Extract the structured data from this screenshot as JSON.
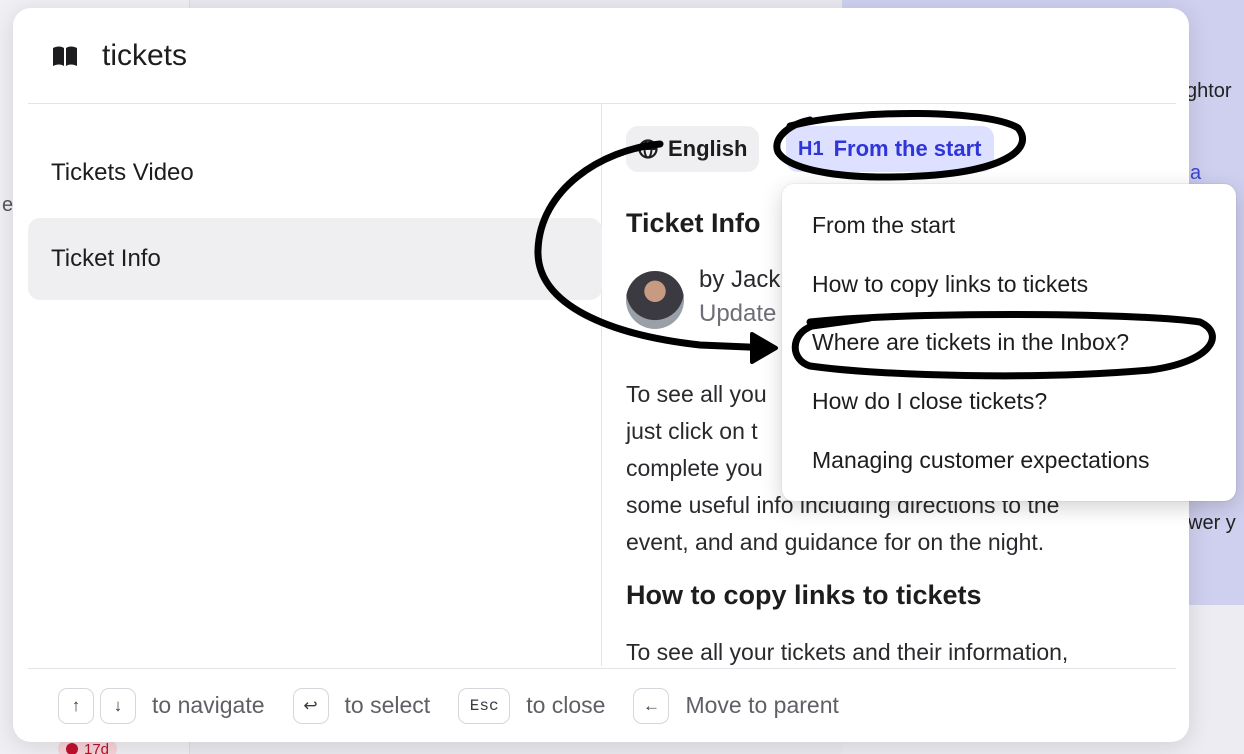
{
  "background": {
    "fragment_top": "ghtor",
    "fragment_link": "a",
    "fragment_mid": "wer y",
    "fragment_left": "e",
    "badge_text": "17d"
  },
  "search": {
    "value": "tickets",
    "icon": "book-icon"
  },
  "results": [
    {
      "label": "Tickets Video",
      "selected": false
    },
    {
      "label": "Ticket Info",
      "selected": true
    }
  ],
  "preview": {
    "language_chip": "English",
    "heading_chip_tag": "H1",
    "heading_chip_label": "From the start",
    "article_title": "Ticket Info",
    "author": "by Jack",
    "updated": "Update",
    "paragraph": "To see all you\njust click on t\ncomplete you\nsome useful info including directions to the\nevent, and and guidance for on the night.",
    "section_heading": "How to copy links to tickets",
    "section_paragraph": "To see all your tickets and their information,"
  },
  "heading_menu": {
    "items": [
      "From the start",
      "How to copy links to tickets",
      "Where are tickets in the Inbox?",
      "How do I close tickets?",
      "Managing customer expectations"
    ]
  },
  "footer": {
    "up_key": "↑",
    "down_key": "↓",
    "navigate": "to navigate",
    "enter_key": "↩",
    "select": "to select",
    "esc_key": "Esc",
    "close": "to close",
    "left_key": "←",
    "parent": "Move to parent"
  },
  "colors": {
    "accent": "#2f35d9",
    "accent_bg": "#dde0ff",
    "selected_bg": "#efeff1"
  }
}
